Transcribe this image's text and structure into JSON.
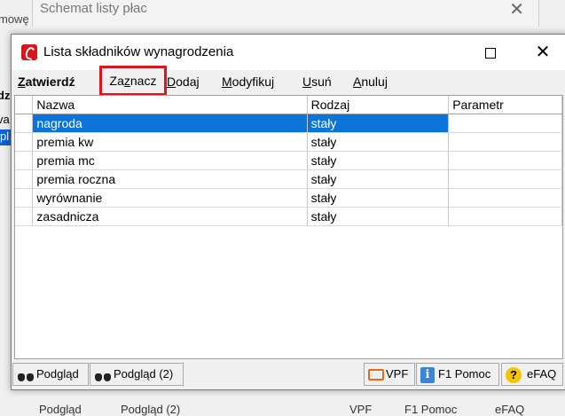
{
  "background": {
    "title": "Schemat listy płac",
    "left_fragments": [
      "mowę",
      "dz",
      "va",
      "pl"
    ],
    "bottom_items": [
      "Podgląd",
      "Podgląd (2)",
      "VPF",
      "F1 Pomoc",
      "eFAQ"
    ]
  },
  "dialog": {
    "title": "Lista składników wynagrodzenia",
    "toolbar": {
      "zatwierdz": {
        "pre": "",
        "u": "Z",
        "post": "atwierdź"
      },
      "zaznacz": {
        "pre": "Za",
        "u": "z",
        "post": "nacz"
      },
      "dodaj": {
        "pre": "",
        "u": "D",
        "post": "odaj"
      },
      "modyfikuj": {
        "pre": "",
        "u": "M",
        "post": "odyfikuj"
      },
      "usun": {
        "pre": "",
        "u": "U",
        "post": "suń"
      },
      "anuluj": {
        "pre": "",
        "u": "A",
        "post": "nuluj"
      }
    },
    "grid": {
      "columns": [
        "Nazwa",
        "Rodzaj",
        "Parametr"
      ],
      "rows": [
        {
          "nazwa": "nagroda",
          "rodzaj": "stały",
          "parametr": "",
          "selected": true
        },
        {
          "nazwa": "premia kw",
          "rodzaj": "stały",
          "parametr": ""
        },
        {
          "nazwa": "premia mc",
          "rodzaj": "stały",
          "parametr": ""
        },
        {
          "nazwa": "premia roczna",
          "rodzaj": "stały",
          "parametr": ""
        },
        {
          "nazwa": "wyrównanie",
          "rodzaj": "stały",
          "parametr": ""
        },
        {
          "nazwa": "zasadnicza",
          "rodzaj": "stały",
          "parametr": ""
        }
      ]
    },
    "footer": {
      "podglad": "Podgląd",
      "podglad2": "Podgląd (2)",
      "vpf": "VPF",
      "pomoc": "F1 Pomoc",
      "efaq": "eFAQ"
    }
  },
  "colors": {
    "selection": "#0a74da",
    "highlight_box": "#e0131f"
  }
}
